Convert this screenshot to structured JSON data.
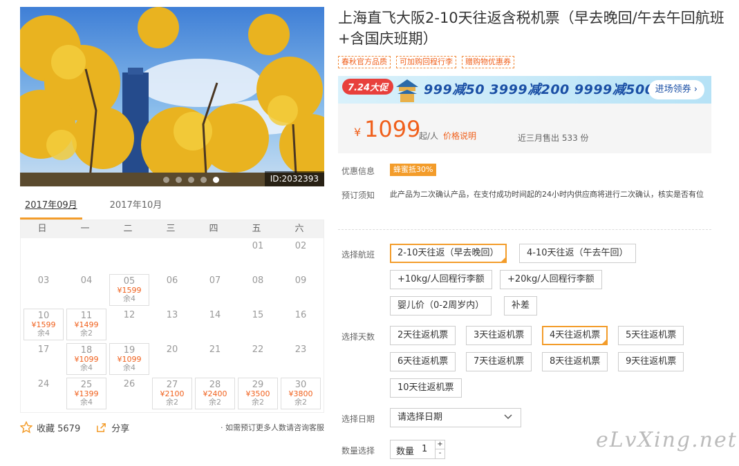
{
  "hero": {
    "image_id": "ID:2032393",
    "dots": 5,
    "active_dot": 4
  },
  "calendar": {
    "tabs": [
      "2017年09月",
      "2017年10月"
    ],
    "weekdays": [
      "日",
      "一",
      "二",
      "三",
      "四",
      "五",
      "六"
    ],
    "days": [
      {
        "d": ""
      },
      {
        "d": ""
      },
      {
        "d": ""
      },
      {
        "d": ""
      },
      {
        "d": ""
      },
      {
        "d": "01"
      },
      {
        "d": "02"
      },
      {
        "d": "03"
      },
      {
        "d": "04"
      },
      {
        "d": "05",
        "price": "¥1599",
        "stock": "余4"
      },
      {
        "d": "06"
      },
      {
        "d": "07"
      },
      {
        "d": "08"
      },
      {
        "d": "09"
      },
      {
        "d": "10",
        "price": "¥1599",
        "stock": "余4"
      },
      {
        "d": "11",
        "price": "¥1499",
        "stock": "余2"
      },
      {
        "d": "12"
      },
      {
        "d": "13"
      },
      {
        "d": "14"
      },
      {
        "d": "15"
      },
      {
        "d": "16"
      },
      {
        "d": "17"
      },
      {
        "d": "18",
        "price": "¥1099",
        "stock": "余4"
      },
      {
        "d": "19",
        "price": "¥1099",
        "stock": "余4"
      },
      {
        "d": "20"
      },
      {
        "d": "21"
      },
      {
        "d": "22"
      },
      {
        "d": "23"
      },
      {
        "d": "24"
      },
      {
        "d": "25",
        "price": "¥1399",
        "stock": "余4"
      },
      {
        "d": "26"
      },
      {
        "d": "27",
        "price": "¥2100",
        "stock": "余2"
      },
      {
        "d": "28",
        "price": "¥2400",
        "stock": "余2"
      },
      {
        "d": "29",
        "price": "¥3500",
        "stock": "余2"
      },
      {
        "d": "30",
        "price": "¥3800",
        "stock": "余2"
      }
    ]
  },
  "footer_left": {
    "favorite_label": "收藏 5679",
    "share_label": "分享",
    "note": "· 如需预订更多人数请咨询客服"
  },
  "product": {
    "title": "上海直飞大阪2-10天往返含税机票（早去晚回/午去午回航班+含国庆班期）",
    "tags": [
      "春秋官方品质",
      "可加购回程行李",
      "赠购物优惠券"
    ]
  },
  "promo": {
    "badge": "7.24大促",
    "text": "999减50  3999减200  9999减500",
    "button": "进场领券 ›"
  },
  "price": {
    "symbol": "¥",
    "value": "1099",
    "unit": "起/人",
    "explain": "价格说明",
    "sold": "近三月售出 533 份"
  },
  "info": {
    "discount_label": "优惠信息",
    "discount_badge": "蜂蜜抵30%",
    "notice_label": "预订须知",
    "notice_text": "此产品为二次确认产品，在支付成功时间起的24小时内供应商将进行二次确认，核实是否有位"
  },
  "options": {
    "flight_label": "选择航班",
    "flights": [
      "2-10天往返（早去晚回）",
      "4-10天往返（午去午回）",
      "+10kg/人回程行李额",
      "+20kg/人回程行李额",
      "婴儿价（0-2周岁内）",
      "补差"
    ],
    "days_label": "选择天数",
    "days": [
      "2天往返机票",
      "3天往返机票",
      "4天往返机票",
      "5天往返机票",
      "6天往返机票",
      "7天往返机票",
      "8天往返机票",
      "9天往返机票",
      "10天往返机票"
    ],
    "date_label": "选择日期",
    "date_placeholder": "请选择日期",
    "qty_label_row": "数量选择",
    "qty_label": "数量",
    "qty_value": "1"
  },
  "watermark": "eLvXing.net",
  "colors": {
    "accent": "#f0601c",
    "selected_border": "#f39c2a"
  }
}
